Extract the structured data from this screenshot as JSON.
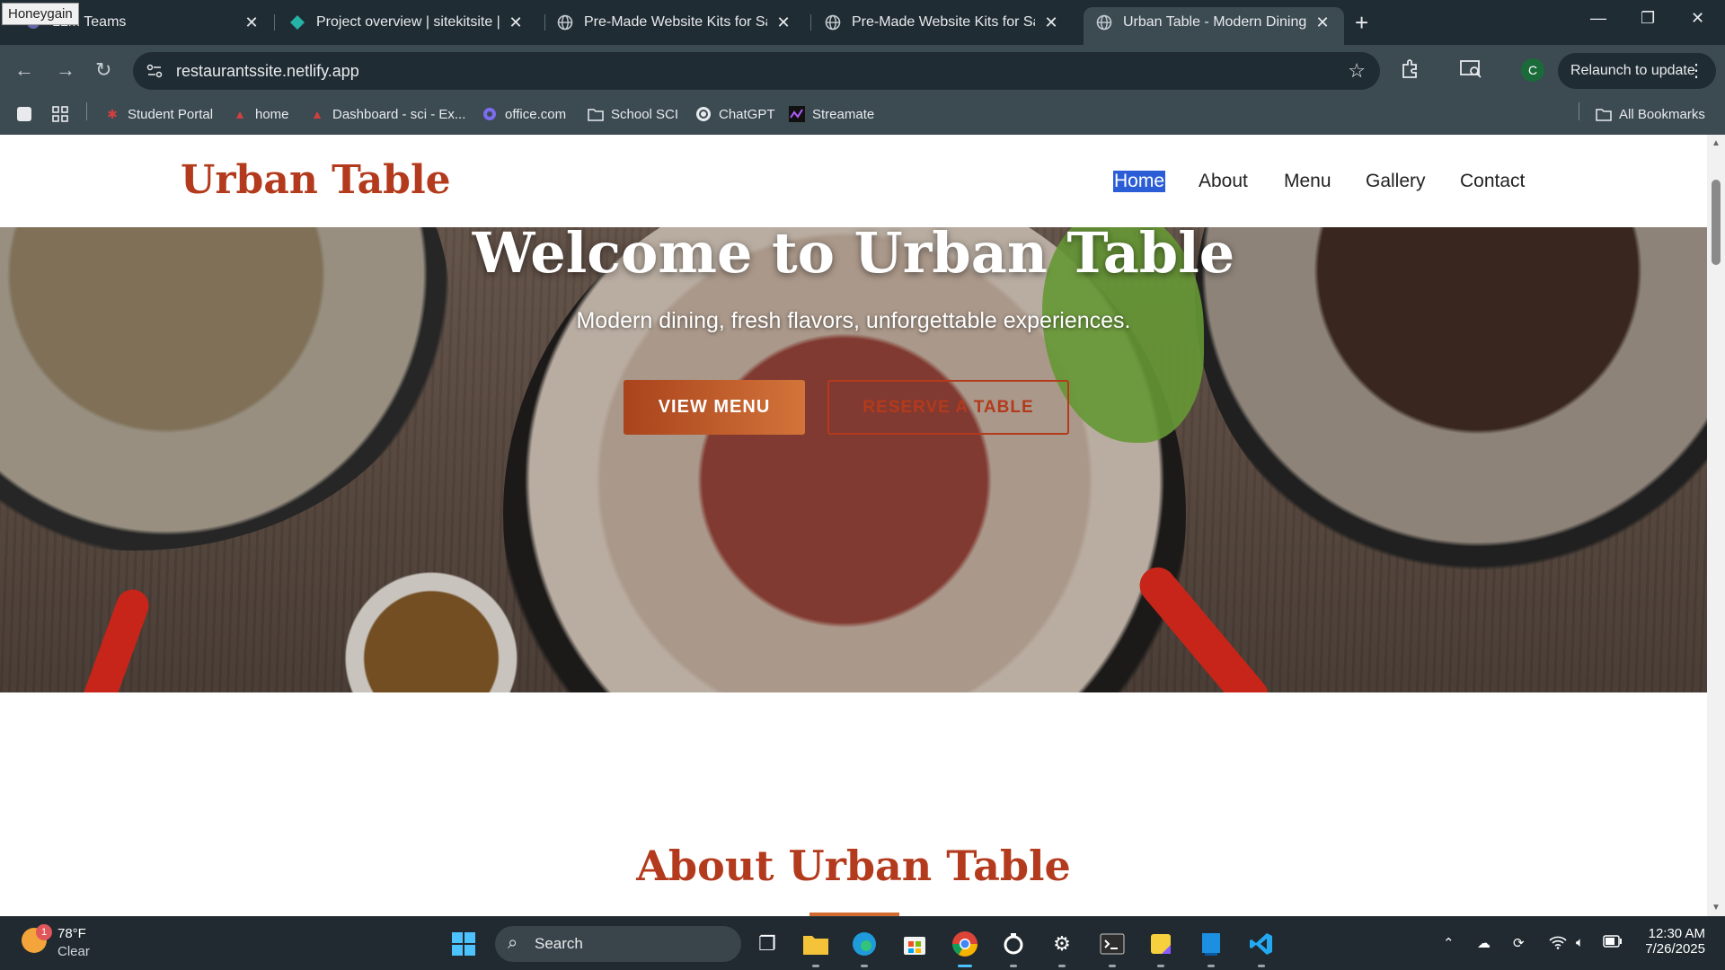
{
  "tooltip": "Honeygain",
  "tabs": [
    {
      "title": "LLM Teams",
      "active": false
    },
    {
      "title": "Project overview | sitekitsite | N",
      "active": false
    },
    {
      "title": "Pre-Made Website Kits for Sale",
      "active": false
    },
    {
      "title": "Pre-Made Website Kits for Sale",
      "active": false
    },
    {
      "title": "Urban Table - Modern Dining E",
      "active": true
    }
  ],
  "address": {
    "url": "restaurantssite.netlify.app"
  },
  "profile_initial": "C",
  "relaunch_label": "Relaunch to update",
  "bookmarks": [
    {
      "label": "Student Portal"
    },
    {
      "label": "home"
    },
    {
      "label": "Dashboard - sci - Ex..."
    },
    {
      "label": "office.com"
    },
    {
      "label": "School SCI"
    },
    {
      "label": "ChatGPT"
    },
    {
      "label": "Streamate"
    }
  ],
  "all_bookmarks": "All Bookmarks",
  "site": {
    "logo": "Urban Table",
    "nav": [
      "Home",
      "About",
      "Menu",
      "Gallery",
      "Contact"
    ],
    "hero_title": "Welcome to Urban Table",
    "hero_subtitle": "Modern dining, fresh flavors, unforgettable experiences.",
    "btn_menu": "VIEW MENU",
    "btn_reserve": "RESERVE A TABLE",
    "about_title": "About Urban Table"
  },
  "taskbar": {
    "weather_temp": "78°F",
    "weather_cond": "Clear",
    "weather_badge": "1",
    "search_label": "Search",
    "time": "12:30 AM",
    "date": "7/26/2025"
  },
  "colors": {
    "brand": "#b33a1c",
    "button_gradient_start": "#a9431c",
    "button_gradient_end": "#d3743a",
    "chrome_dark": "#202c33",
    "chrome_mid": "#3c4a52"
  }
}
